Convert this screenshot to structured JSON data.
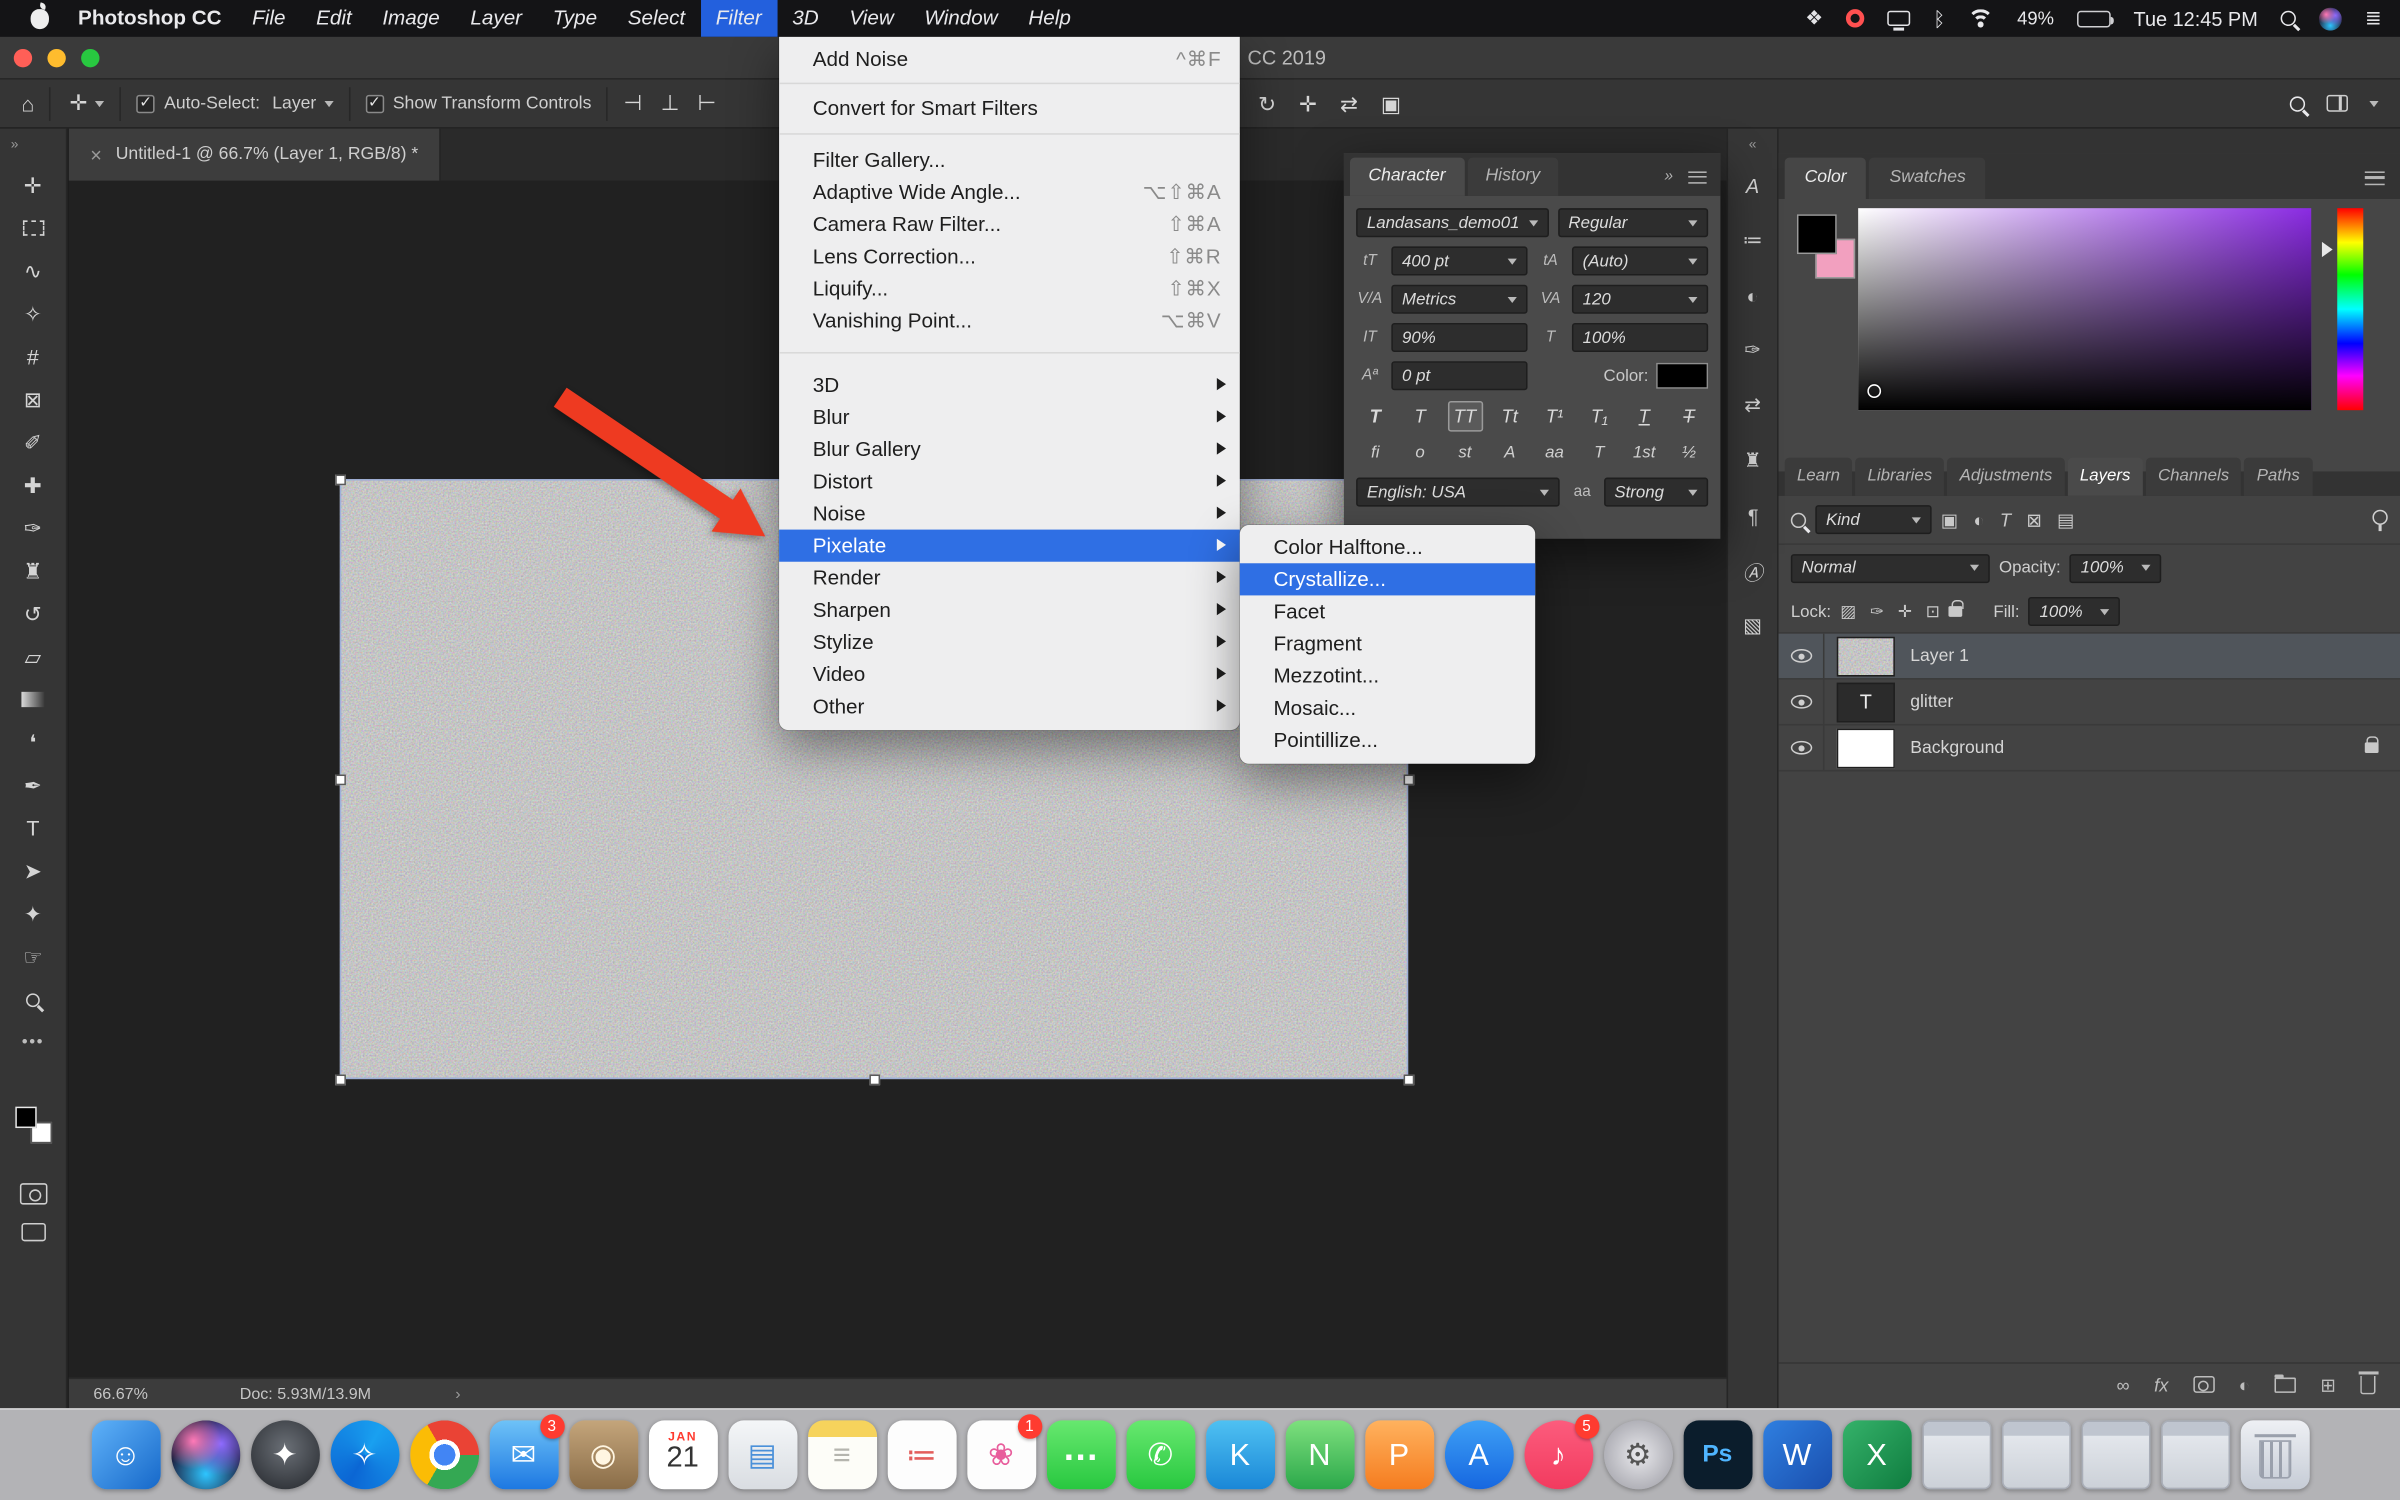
{
  "colors": {
    "menu_highlight": "#2f6fe4",
    "menubar_highlight": "#2360dd",
    "accent_red": "#ee3a21"
  },
  "menubar": {
    "app_name": "Photoshop CC",
    "menus": [
      {
        "name": "menu-file",
        "label": "File"
      },
      {
        "name": "menu-edit",
        "label": "Edit"
      },
      {
        "name": "menu-image",
        "label": "Image"
      },
      {
        "name": "menu-layer",
        "label": "Layer"
      },
      {
        "name": "menu-type",
        "label": "Type"
      },
      {
        "name": "menu-select",
        "label": "Select"
      },
      {
        "name": "menu-filter",
        "label": "Filter",
        "selected": true
      },
      {
        "name": "menu-3d",
        "label": "3D"
      },
      {
        "name": "menu-view",
        "label": "View"
      },
      {
        "name": "menu-window",
        "label": "Window"
      },
      {
        "name": "menu-help",
        "label": "Help"
      }
    ],
    "battery": "49%",
    "clock": "Tue 12:45 PM",
    "icons": {
      "dropbox": "❖",
      "bluetooth": "ᛒ",
      "list": "≣"
    }
  },
  "window": {
    "title": "CC 2019"
  },
  "filter_menu": {
    "items": [
      {
        "name": "menu-item-add-noise",
        "label": "Add Noise",
        "shortcut": "^⌘F"
      },
      {
        "type": "separator",
        "cls": "sep-s"
      },
      {
        "name": "menu-item-convert-for-smart-filters",
        "label": "Convert for Smart Filters"
      },
      {
        "type": "separator",
        "cls": "sep-m"
      },
      {
        "name": "menu-item-filter-gallery",
        "label": "Filter Gallery..."
      },
      {
        "name": "menu-item-adaptive-wide-angle",
        "label": "Adaptive Wide Angle...",
        "shortcut": "⌥⇧⌘A"
      },
      {
        "name": "menu-item-camera-raw-filter",
        "label": "Camera Raw Filter...",
        "shortcut": "⇧⌘A"
      },
      {
        "name": "menu-item-lens-correction",
        "label": "Lens Correction...",
        "shortcut": "⇧⌘R"
      },
      {
        "name": "menu-item-liquify",
        "label": "Liquify...",
        "shortcut": "⇧⌘X"
      },
      {
        "name": "menu-item-vanishing-point",
        "label": "Vanishing Point...",
        "shortcut": "⌥⌘V"
      },
      {
        "type": "separator",
        "cls": "sep-l"
      },
      {
        "name": "menu-item-3d",
        "label": "3D",
        "submenu": true
      },
      {
        "name": "menu-item-blur",
        "label": "Blur",
        "submenu": true
      },
      {
        "name": "menu-item-blur-gallery",
        "label": "Blur Gallery",
        "submenu": true
      },
      {
        "name": "menu-item-distort",
        "label": "Distort",
        "submenu": true
      },
      {
        "name": "menu-item-noise",
        "label": "Noise",
        "submenu": true
      },
      {
        "name": "menu-item-pixelate",
        "label": "Pixelate",
        "submenu": true,
        "selected": true
      },
      {
        "name": "menu-item-render",
        "label": "Render",
        "submenu": true
      },
      {
        "name": "menu-item-sharpen",
        "label": "Sharpen",
        "submenu": true
      },
      {
        "name": "menu-item-stylize",
        "label": "Stylize",
        "submenu": true
      },
      {
        "name": "menu-item-video",
        "label": "Video",
        "submenu": true
      },
      {
        "name": "menu-item-other",
        "label": "Other",
        "submenu": true
      }
    ]
  },
  "pixelate_submenu": {
    "items": [
      {
        "name": "menu-item-color-halftone",
        "label": "Color Halftone..."
      },
      {
        "name": "menu-item-crystallize",
        "label": "Crystallize...",
        "selected": true
      },
      {
        "name": "menu-item-facet",
        "label": "Facet"
      },
      {
        "name": "menu-item-fragment",
        "label": "Fragment"
      },
      {
        "name": "menu-item-mezzotint",
        "label": "Mezzotint..."
      },
      {
        "name": "menu-item-mosaic",
        "label": "Mosaic..."
      },
      {
        "name": "menu-item-pointillize",
        "label": "Pointillize..."
      }
    ]
  },
  "options_bar": {
    "home_icon": "⌂",
    "move_icon": "✛",
    "check_glyph": "✓",
    "auto_select_label": "Auto-Select:",
    "auto_select_value": "Layer",
    "show_transform_label": "Show Transform Controls",
    "align_icons": [
      {
        "name": "align-left-icon",
        "glyph": "⊣"
      },
      {
        "name": "align-center-icon",
        "glyph": "⊥"
      },
      {
        "name": "align-right-icon",
        "glyph": "⊢"
      }
    ],
    "mode_icons": [
      {
        "name": "orbit-3d-icon",
        "glyph": "↻"
      },
      {
        "name": "pan-3d-icon",
        "glyph": "✛"
      },
      {
        "name": "slide-3d-icon",
        "glyph": "⇄"
      },
      {
        "name": "camera-3d-icon",
        "glyph": "▣"
      }
    ]
  },
  "document": {
    "tab_close": "×",
    "tab_title": "Untitled-1 @ 66.7% (Layer 1, RGB/8) *",
    "zoom": "66.67%",
    "doc_size": "Doc: 5.93M/13.9M",
    "status_chevron": "›"
  },
  "left_collapse": "»",
  "tools": [
    {
      "name": "move-tool",
      "glyph": "✛"
    },
    {
      "name": "rectangular-marquee-tool",
      "glyph": "",
      "cls": "dash"
    },
    {
      "name": "lasso-tool",
      "glyph": "∿"
    },
    {
      "name": "object-selection-tool",
      "glyph": "✧"
    },
    {
      "name": "crop-tool",
      "glyph": "#"
    },
    {
      "name": "frame-tool",
      "glyph": "⊠"
    },
    {
      "name": "eyedropper-tool",
      "glyph": "✐"
    },
    {
      "name": "healing-brush-tool",
      "glyph": "✚"
    },
    {
      "name": "brush-tool",
      "glyph": "✑"
    },
    {
      "name": "clone-stamp-tool",
      "glyph": "♜"
    },
    {
      "name": "history-brush-tool",
      "glyph": "↺"
    },
    {
      "name": "eraser-tool",
      "glyph": "▱"
    },
    {
      "name": "gradient-tool",
      "glyph": "",
      "cls": "grad"
    },
    {
      "name": "dodge-tool",
      "glyph": "❛"
    },
    {
      "name": "pen-tool",
      "glyph": "✒"
    },
    {
      "name": "type-tool",
      "glyph": "T"
    },
    {
      "name": "path-selection-tool",
      "glyph": "➤"
    },
    {
      "name": "custom-shape-tool",
      "glyph": "✦"
    },
    {
      "name": "hand-tool",
      "glyph": "☞"
    },
    {
      "name": "zoom-tool",
      "glyph": "",
      "cls": "mag"
    }
  ],
  "tools_extra": {
    "more": "•••"
  },
  "panel_strip": {
    "collapse": "«",
    "icons": [
      {
        "name": "character-styles-panel-icon",
        "glyph": "A"
      },
      {
        "name": "brush-settings-panel-icon",
        "glyph": "≔"
      },
      {
        "name": "adjustments-panel-icon",
        "glyph": "◐"
      },
      {
        "name": "brushes-panel-icon",
        "glyph": "✑"
      },
      {
        "name": "history-panel-icon",
        "glyph": "⇄"
      },
      {
        "name": "clone-source-panel-icon",
        "glyph": "♜"
      },
      {
        "name": "paragraph-panel-icon",
        "glyph": "¶"
      },
      {
        "name": "glyphs-panel-icon",
        "glyph": "Ⓐ"
      },
      {
        "name": "3d-panel-icon",
        "glyph": "▧"
      }
    ]
  },
  "character_panel": {
    "tabs": [
      {
        "name": "tab-character",
        "label": "Character",
        "selected": true
      },
      {
        "name": "tab-history",
        "label": "History"
      }
    ],
    "expand_icon": "»",
    "font_family": "Landasans_demo01",
    "font_style": "Regular",
    "size_value": "400 pt",
    "leading_value": "(Auto)",
    "kerning_value": "Metrics",
    "tracking_value": "120",
    "vertical_scale": "90%",
    "horizontal_scale": "100%",
    "baseline_value": "0 pt",
    "color_label": "Color:",
    "language_value": "English: USA",
    "anti_alias_value": "Strong",
    "icons": {
      "size": "tT",
      "leading": "tA",
      "kerning": "V/A",
      "tracking": "VA",
      "vscale": "IT",
      "hscale": "T",
      "baseline": "Aª",
      "anti_alias": "aa"
    },
    "format_buttons": [
      {
        "name": "faux-bold-button",
        "glyph": "T",
        "cls": "b"
      },
      {
        "name": "faux-italic-button",
        "glyph": "T",
        "cls": "i"
      },
      {
        "name": "all-caps-button",
        "glyph": "TT",
        "selected": true
      },
      {
        "name": "small-caps-button",
        "glyph": "Tt"
      },
      {
        "name": "superscript-button",
        "glyph": "T¹"
      },
      {
        "name": "subscript-button",
        "glyph": "T₁"
      },
      {
        "name": "underline-button",
        "glyph": "T",
        "cls": "u"
      },
      {
        "name": "strikethrough-button",
        "glyph": "T",
        "cls": "s"
      }
    ],
    "opentype_buttons": [
      {
        "name": "ligatures-button",
        "glyph": "fi"
      },
      {
        "name": "ordinals-button",
        "glyph": "o",
        "cls": "i"
      },
      {
        "name": "discretionary-ligatures-button",
        "glyph": "st"
      },
      {
        "name": "swash-button",
        "glyph": "A",
        "cls": "i"
      },
      {
        "name": "stylistic-alternates-button",
        "glyph": "aa"
      },
      {
        "name": "titling-alternates-button",
        "glyph": "T"
      },
      {
        "name": "ordinal-button",
        "glyph": "1st"
      },
      {
        "name": "fractions-button",
        "glyph": "½"
      }
    ]
  },
  "color_panel": {
    "tabs": [
      {
        "name": "tab-color",
        "label": "Color",
        "selected": true
      },
      {
        "name": "tab-swatches",
        "label": "Swatches"
      }
    ]
  },
  "right_tabs": [
    {
      "name": "tab-learn",
      "label": "Learn"
    },
    {
      "name": "tab-libraries",
      "label": "Libraries"
    },
    {
      "name": "tab-adjustments",
      "label": "Adjustments"
    },
    {
      "name": "tab-layers",
      "label": "Layers",
      "selected": true
    },
    {
      "name": "tab-channels",
      "label": "Channels"
    },
    {
      "name": "tab-paths",
      "label": "Paths"
    }
  ],
  "layers_panel": {
    "kind_label": "Kind",
    "filter_icons": [
      {
        "name": "filter-pixel-layers-icon",
        "glyph": "▣"
      },
      {
        "name": "filter-adjustment-layers-icon",
        "glyph": "◐"
      },
      {
        "name": "filter-type-layers-icon",
        "glyph": "T"
      },
      {
        "name": "filter-shape-layers-icon",
        "glyph": "⊠"
      },
      {
        "name": "filter-smart-objects-icon",
        "glyph": "▤"
      }
    ],
    "blend_mode": "Normal",
    "opacity_label": "Opacity:",
    "opacity_value": "100%",
    "lock_label": "Lock:",
    "lock_icons": [
      {
        "name": "lock-transparent-pixels-icon",
        "glyph": "▨"
      },
      {
        "name": "lock-image-pixels-icon",
        "glyph": "✑"
      },
      {
        "name": "lock-position-icon",
        "glyph": "✛"
      },
      {
        "name": "lock-artboard-icon",
        "glyph": "⊡"
      }
    ],
    "fill_label": "Fill:",
    "fill_value": "100%",
    "layers": [
      {
        "name": "layer-row-layer-1",
        "label": "Layer 1",
        "cls": "t-noise",
        "selected": true
      },
      {
        "name": "layer-row-glitter",
        "label": "glitter",
        "cls": "t-text",
        "thumb_glyph": "T"
      },
      {
        "name": "layer-row-background",
        "label": "Background",
        "cls": "t-white",
        "locked": true
      }
    ],
    "bottom_icons": {
      "link": "∞",
      "fx": "fx",
      "adjust": "◐",
      "new_layer": "⊞"
    }
  },
  "dock": [
    {
      "name": "dock-finder",
      "glyph": "☺",
      "bg": "linear-gradient(135deg,#5fb2f9,#1668c9)"
    },
    {
      "name": "dock-siri",
      "cls": "circle siri",
      "glyph": ""
    },
    {
      "name": "dock-launchpad",
      "cls": "circle",
      "glyph": "✦",
      "bg": "radial-gradient(circle at 50% 40%,#6a6f76,#23262b)"
    },
    {
      "name": "dock-safari",
      "cls": "circle",
      "glyph": "✧",
      "bg": "conic-gradient(from 30deg,#19a0f0,#0b66d4,#19a0f0)"
    },
    {
      "name": "dock-chrome",
      "cls": "circle chrome",
      "glyph": ""
    },
    {
      "name": "dock-mail",
      "glyph": "✉",
      "bg": "linear-gradient(180deg,#6ec2f7,#1d78e2)",
      "badge": "3"
    },
    {
      "name": "dock-photo-booth",
      "glyph": "◉",
      "bg": "linear-gradient(180deg,#c4a57b,#8a6d48)",
      "fg": "#fff6e2"
    },
    {
      "name": "dock-calendar",
      "cls": "cal",
      "bg": "#ffffff",
      "cal_top": "JAN",
      "cal_day": "21"
    },
    {
      "name": "dock-files",
      "glyph": "▤",
      "bg": "linear-gradient(180deg,#f4f6f8,#d9dde2)",
      "fg": "#4a90d9"
    },
    {
      "name": "dock-notes",
      "glyph": "≡",
      "bg": "linear-gradient(180deg,#f6d35c 24%,#fdfdf8 24%)",
      "fg": "#b5b5ae"
    },
    {
      "name": "dock-reminders",
      "glyph": "≔",
      "bg": "#fdfdfd",
      "fg": "#e35d5b"
    },
    {
      "name": "dock-photos",
      "glyph": "❀",
      "bg": "#fdfdfd",
      "fg": "#e85d9c",
      "badge": "1"
    },
    {
      "name": "dock-messages",
      "cls": "msg",
      "glyph": "…",
      "bg": "linear-gradient(180deg,#67e86f,#28c840)"
    },
    {
      "name": "dock-facetime",
      "glyph": "✆",
      "bg": "linear-gradient(180deg,#67e86f,#28c840)"
    },
    {
      "name": "dock-keynote",
      "glyph": "K",
      "bg": "linear-gradient(180deg,#4fc1f2,#1a87d7)"
    },
    {
      "name": "dock-numbers",
      "glyph": "N",
      "bg": "linear-gradient(180deg,#7ee07e,#2ba84a)"
    },
    {
      "name": "dock-pages",
      "glyph": "P",
      "bg": "linear-gradient(180deg,#ffb25e,#f57c1f)"
    },
    {
      "name": "dock-app-store",
      "cls": "circle",
      "glyph": "A",
      "bg": "linear-gradient(180deg,#3ea0f6,#1667e0)"
    },
    {
      "name": "dock-music",
      "cls": "circle",
      "glyph": "♪",
      "bg": "linear-gradient(180deg,#fc5c7d,#f23b5f)",
      "badge": "5"
    },
    {
      "name": "dock-system-preferences",
      "cls": "circle",
      "glyph": "⚙",
      "bg": "radial-gradient(circle,#e8e8ec,#9a9aa2)",
      "fg": "#555"
    },
    {
      "name": "dock-photoshop",
      "cls": "ps",
      "glyph": "Ps",
      "bg": "#0b1d2c",
      "fg": "#4fb5ff"
    },
    {
      "name": "dock-word",
      "glyph": "W",
      "bg": "linear-gradient(135deg,#2f7fe0,#1a4fae)"
    },
    {
      "name": "dock-excel",
      "glyph": "X",
      "bg": "linear-gradient(135deg,#35b26a,#0f7c3f)"
    },
    {
      "name": "dock-window-1",
      "cls": "win-thumb",
      "glyph": ""
    },
    {
      "name": "dock-window-2",
      "cls": "win-thumb",
      "glyph": ""
    },
    {
      "name": "dock-window-3",
      "cls": "win-thumb",
      "glyph": ""
    },
    {
      "name": "dock-window-4",
      "cls": "win-thumb",
      "glyph": ""
    },
    {
      "name": "dock-trash",
      "cls": "trash",
      "glyph": ""
    }
  ]
}
